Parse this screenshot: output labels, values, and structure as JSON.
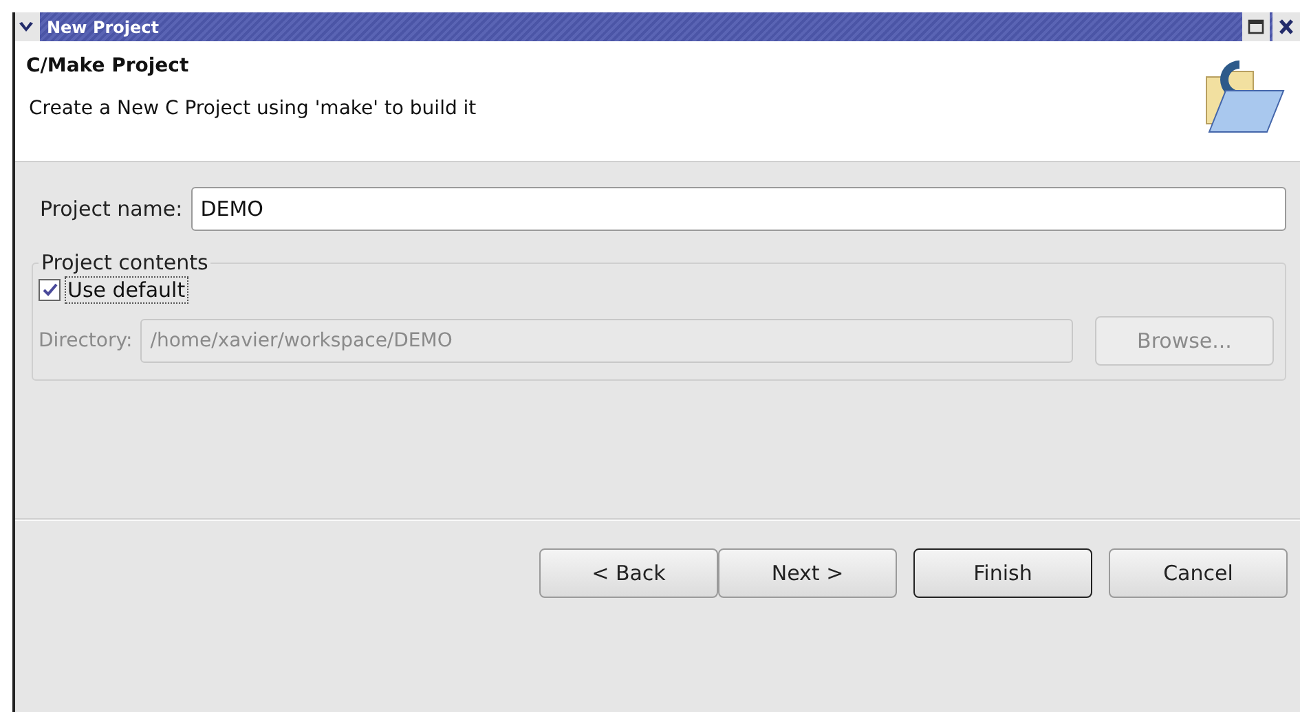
{
  "window": {
    "title": "New Project"
  },
  "header": {
    "title": "C/Make Project",
    "description": "Create a New C Project using 'make' to build it"
  },
  "project_name": {
    "label": "Project name:",
    "value": "DEMO"
  },
  "contents": {
    "title": "Project contents",
    "use_default": {
      "label": "Use default",
      "checked": true
    },
    "directory": {
      "label": "Directory:",
      "value": "/home/xavier/workspace/DEMO",
      "disabled": true
    },
    "browse": {
      "label": "Browse...",
      "disabled": true
    }
  },
  "buttons": [
    {
      "label": "< Back",
      "default": false
    },
    {
      "label": "Next >",
      "default": false
    },
    {
      "label": "Finish",
      "default": true
    },
    {
      "label": "Cancel",
      "default": false
    }
  ]
}
